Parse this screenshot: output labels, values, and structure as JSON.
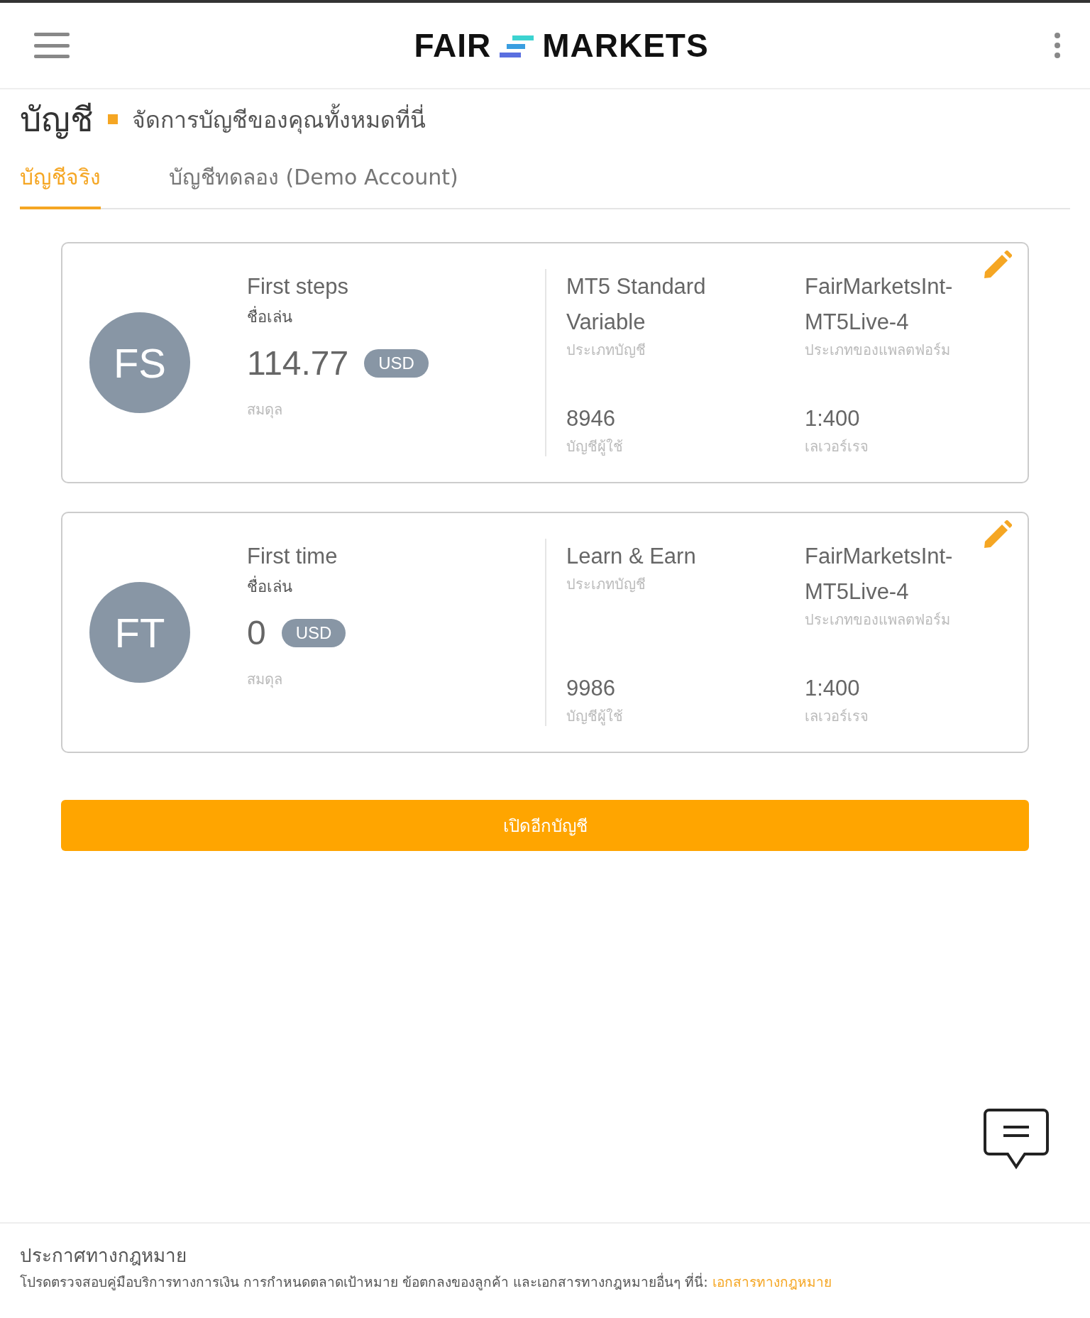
{
  "header": {
    "logo_left": "FAIR",
    "logo_right": "MARKETS"
  },
  "page": {
    "title": "บัญชี",
    "subtitle": "จัดการบัญชีของคุณทั้งหมดที่นี่"
  },
  "tabs": [
    {
      "label": "บัญชีจริง",
      "selected": true
    },
    {
      "label": "บัญชีทดลอง (Demo Account)",
      "selected": false
    }
  ],
  "accounts": [
    {
      "initials": "FS",
      "nickname": "First steps",
      "nickname_label": "ชื่อเล่น",
      "balance": "114.77",
      "currency": "USD",
      "balance_label": "สมดุล",
      "account_type": "MT5 Standard Variable",
      "account_type_label": "ประเภทบัญชี",
      "platform": "FairMarketsInt-MT5Live-4",
      "platform_label": "ประเภทของแพลตฟอร์ม",
      "account_number": "8946",
      "account_number_label": "บัญชีผู้ใช้",
      "leverage": "1:400",
      "leverage_label": "เลเวอร์เรจ"
    },
    {
      "initials": "FT",
      "nickname": "First time",
      "nickname_label": "ชื่อเล่น",
      "balance": "0",
      "currency": "USD",
      "balance_label": "สมดุล",
      "account_type": "Learn & Earn",
      "account_type_label": "ประเภทบัญชี",
      "platform": "FairMarketsInt-MT5Live-4",
      "platform_label": "ประเภทของแพลตฟอร์ม",
      "account_number": "9986",
      "account_number_label": "บัญชีผู้ใช้",
      "leverage": "1:400",
      "leverage_label": "เลเวอร์เรจ"
    }
  ],
  "open_account_button": "เปิดอีกบัญชี",
  "footer": {
    "title": "ประกาศทางกฎหมาย",
    "text": "โปรดตรวจสอบคู่มือบริการทางการเงิน การกำหนดตลาดเป้าหมาย ข้อตกลงของลูกค้า และเอกสารทางกฎหมายอื่นๆ ที่นี่:",
    "link": "เอกสารทางกฎหมาย"
  }
}
